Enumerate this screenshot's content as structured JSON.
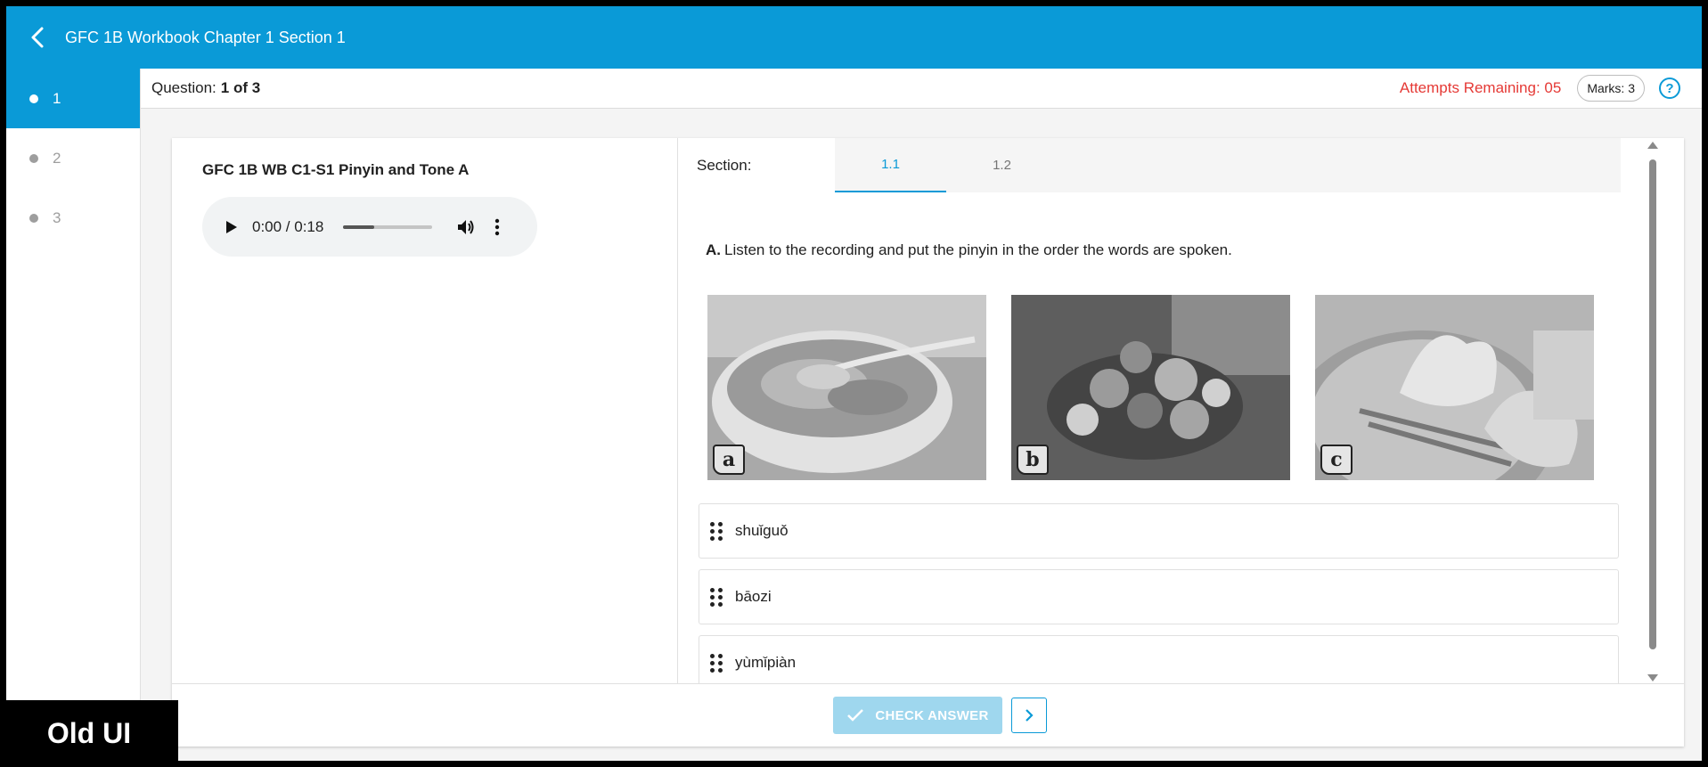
{
  "header": {
    "title": "GFC 1B Workbook Chapter 1 Section 1",
    "back_icon": "chevron-left-icon"
  },
  "sidebar": {
    "items": [
      {
        "label": "1",
        "active": true
      },
      {
        "label": "2",
        "active": false
      },
      {
        "label": "3",
        "active": false
      }
    ]
  },
  "question_bar": {
    "prefix": "Question:",
    "number": "1 of 3",
    "attempts": "Attempts Remaining: 05",
    "marks": "Marks: 3",
    "help_glyph": "?"
  },
  "activity": {
    "title": "GFC 1B WB C1-S1 Pinyin and Tone A",
    "audio": {
      "time": "0:00 / 0:18",
      "progress": 0.35
    }
  },
  "section": {
    "label": "Section:",
    "tabs": [
      {
        "label": "1.1",
        "active": true
      },
      {
        "label": "1.2",
        "active": false
      }
    ]
  },
  "instruction": {
    "prefix": "A.",
    "text": "Listen to the recording and put the pinyin in the order the words are spoken."
  },
  "images": [
    {
      "letter": "a",
      "subject": "bowl of cereal"
    },
    {
      "letter": "b",
      "subject": "plate of fruit"
    },
    {
      "letter": "c",
      "subject": "steamed buns"
    }
  ],
  "answers": [
    "shuǐguǒ",
    "bāozi",
    "yùmǐpiàn"
  ],
  "footer": {
    "check_label": "CHECK ANSWER"
  },
  "overlay_label": "Old UI",
  "colors": {
    "primary": "#0a9ad7",
    "attempts": "#e53935",
    "check_disabled": "#9fd7ee"
  }
}
